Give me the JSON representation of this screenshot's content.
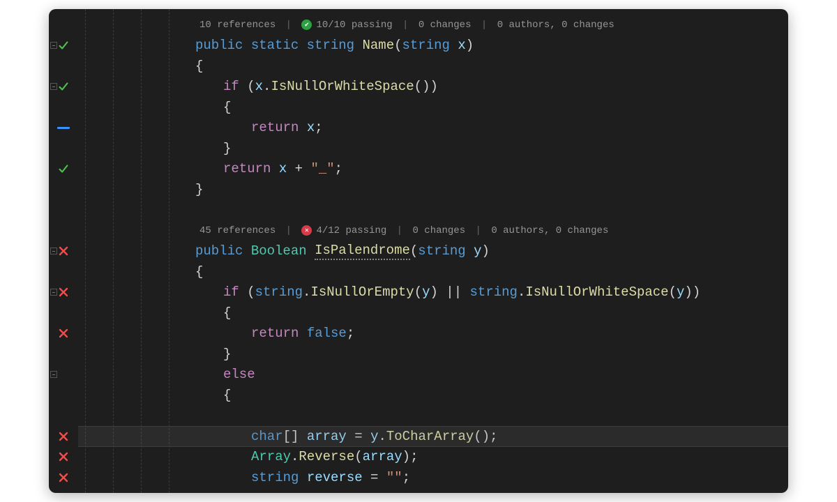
{
  "codelens1": {
    "refs": "10 references",
    "passing": "10/10 passing",
    "changes": "0 changes",
    "authors": "0 authors, 0 changes",
    "status": "pass"
  },
  "codelens2": {
    "refs": "45 references",
    "passing": "4/12 passing",
    "changes": "0 changes",
    "authors": "0 authors, 0 changes",
    "status": "fail"
  },
  "gutter": [
    {
      "mark": "",
      "fold": false
    },
    {
      "mark": "check",
      "fold": true
    },
    {
      "mark": "",
      "fold": false
    },
    {
      "mark": "check",
      "fold": true
    },
    {
      "mark": "",
      "fold": false
    },
    {
      "mark": "bar",
      "fold": false
    },
    {
      "mark": "",
      "fold": false
    },
    {
      "mark": "check",
      "fold": false
    },
    {
      "mark": "",
      "fold": false
    },
    {
      "mark": "",
      "fold": false
    },
    {
      "mark": "",
      "fold": false
    },
    {
      "mark": "x",
      "fold": true
    },
    {
      "mark": "",
      "fold": false
    },
    {
      "mark": "x",
      "fold": true
    },
    {
      "mark": "",
      "fold": false
    },
    {
      "mark": "x",
      "fold": false
    },
    {
      "mark": "",
      "fold": false
    },
    {
      "mark": "",
      "fold": true
    },
    {
      "mark": "",
      "fold": false
    },
    {
      "mark": "",
      "fold": false
    },
    {
      "mark": "x",
      "fold": false
    },
    {
      "mark": "x",
      "fold": false
    },
    {
      "mark": "x",
      "fold": false
    }
  ],
  "tok": {
    "public": "public",
    "static": "static",
    "string": "string",
    "Name": "Name",
    "x": "x",
    "if": "if",
    "IsNullOrWhiteSpace": "IsNullOrWhiteSpace",
    "return": "return",
    "underscore": "\"_\"",
    "Boolean": "Boolean",
    "IsPalendrome": "IsPalendrome",
    "y": "y",
    "IsNullOrEmpty": "IsNullOrEmpty",
    "false": "false",
    "else": "else",
    "char": "char",
    "array": "array",
    "ToCharArray": "ToCharArray",
    "Array": "Array",
    "Reverse": "Reverse",
    "reverse": "reverse",
    "empty": "\"\"",
    "lparen": "(",
    "rparen": ")",
    "lbrace": "{",
    "rbrace": "}",
    "lbrack": "[]",
    "semi": ";",
    "dot": ".",
    "plus": " + ",
    "eq": " = ",
    "sp": " ",
    "or": " || "
  }
}
